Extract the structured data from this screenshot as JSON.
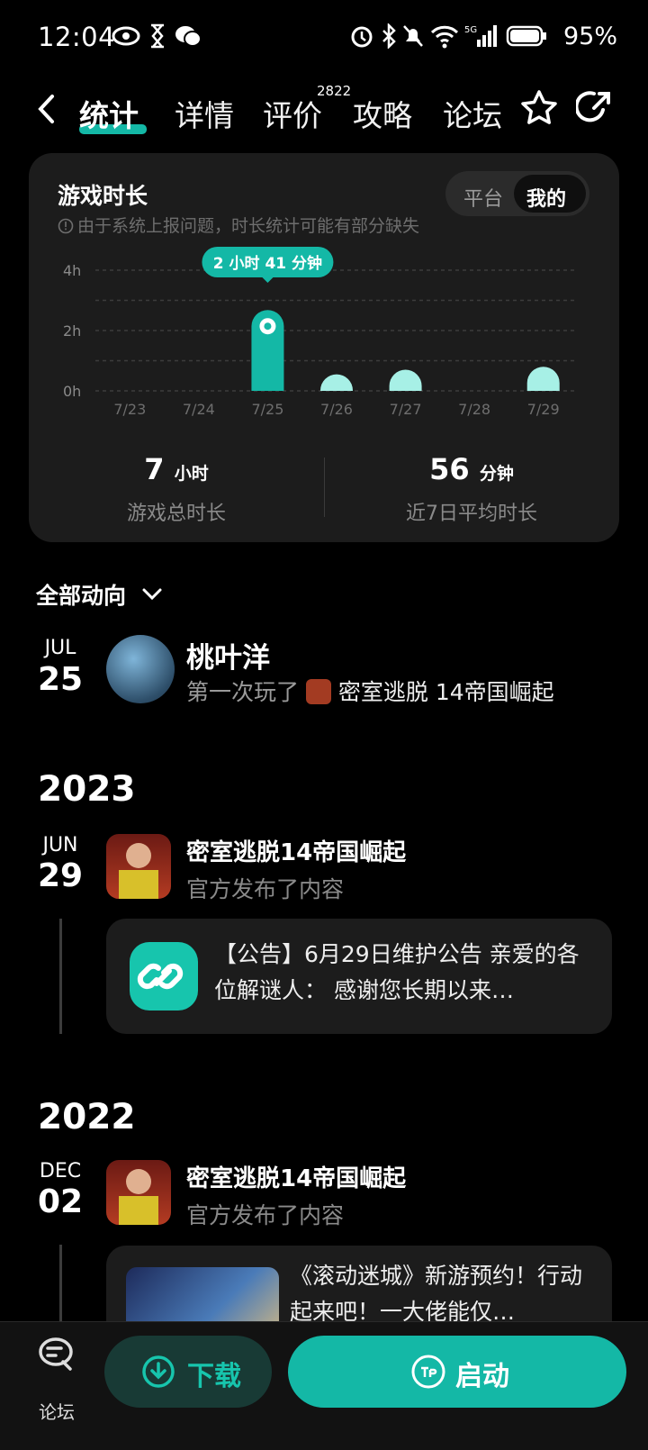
{
  "status_bar": {
    "time": "12:04",
    "battery": "95%",
    "network": "5G"
  },
  "tabs": [
    {
      "label": "统计",
      "active": true
    },
    {
      "label": "详情"
    },
    {
      "label": "评价",
      "badge": "2822"
    },
    {
      "label": "攻略"
    },
    {
      "label": "论坛"
    }
  ],
  "stats_card": {
    "title": "游戏时长",
    "note": "由于系统上报问题，时长统计可能有部分缺失",
    "toggle": {
      "options": [
        "平台",
        "我的"
      ],
      "selected": "我的"
    },
    "tooltip": "2 小时 41 分钟",
    "total": {
      "value": "7",
      "unit": "小时",
      "label": "游戏总时长"
    },
    "average": {
      "value": "56",
      "unit": "分钟",
      "label": "近7日平均时长"
    }
  },
  "chart_data": {
    "type": "bar",
    "categories": [
      "7/23",
      "7/24",
      "7/25",
      "7/26",
      "7/27",
      "7/28",
      "7/29"
    ],
    "values": [
      0,
      0,
      2.68,
      0.55,
      0.7,
      0,
      0.8
    ],
    "highlight_index": 2,
    "yticks": [
      "0h",
      "2h",
      "4h"
    ],
    "ylim": [
      0,
      4
    ],
    "grid": true,
    "colors": {
      "highlight": "#14b8a6",
      "normal": "#a7f0e6"
    }
  },
  "feed": {
    "filter_label": "全部动向",
    "items": [
      {
        "month": "JUL",
        "day": "25",
        "name": "桃叶洋",
        "text_prefix": "第一次玩了",
        "game": "密室逃脱 14帝国崛起"
      },
      {
        "year": "2023",
        "month": "JUN",
        "day": "29",
        "name": "密室逃脱14帝国崛起",
        "sub": "官方发布了内容",
        "post": "【公告】6月29日维护公告 亲爱的各位解谜人：    感谢您长期以来…"
      },
      {
        "year": "2022",
        "month": "DEC",
        "day": "02",
        "name": "密室逃脱14帝国崛起",
        "sub": "官方发布了内容",
        "post": "《滚动迷城》新游预约！行动起来吧！一大佬能仅…"
      }
    ]
  },
  "bottom": {
    "forum_label": "论坛",
    "download_label": "下载",
    "start_label": "启动"
  }
}
